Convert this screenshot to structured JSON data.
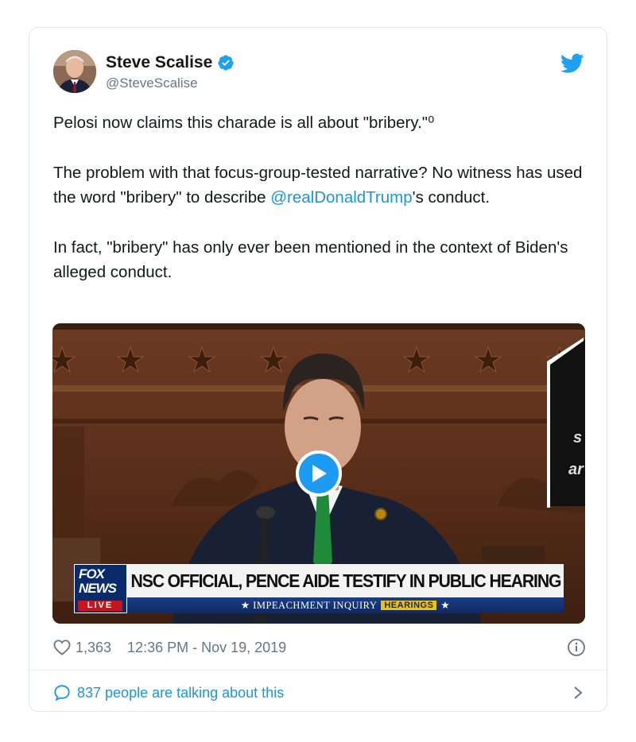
{
  "author": {
    "name": "Steve Scalise",
    "handle": "@SteveScalise"
  },
  "tweet": {
    "para1": "Pelosi now claims this charade is all about \"bribery.\"⁰",
    "para2_before": "The problem with that focus-group-tested narrative? No witness has used the word \"bribery\" to describe ",
    "para2_mention": "@realDonaldTrump",
    "para2_after": "'s conduct.",
    "para3": "In fact, \"bribery\" has only ever been mentioned in the context of Biden's alleged conduct."
  },
  "video": {
    "logo_line1": "FOX",
    "logo_line2": "NEWS",
    "logo_live": "LIVE",
    "headline": "NSC OFFICIAL, PENCE AIDE TESTIFY IN PUBLIC HEARING",
    "sub_left": "★ IMPEACHMENT INQUIRY",
    "sub_tag": "HEARINGS",
    "sub_right": "★",
    "sign_text_1": "s",
    "sign_text_2": "ar"
  },
  "meta": {
    "likes": "1,363",
    "timestamp": "12:36 PM - Nov 19, 2019"
  },
  "conversation": {
    "label": "837 people are talking about this"
  },
  "icons": {
    "verified": "verified-badge-icon",
    "bird": "twitter-bird-icon",
    "heart": "heart-icon",
    "info": "info-icon",
    "bubble": "speech-bubble-icon",
    "chevron": "chevron-right-icon",
    "play": "play-icon"
  },
  "colors": {
    "accent": "#1b95e0",
    "text": "#14171a",
    "muted": "#657786",
    "border": "#e1e8ed"
  }
}
